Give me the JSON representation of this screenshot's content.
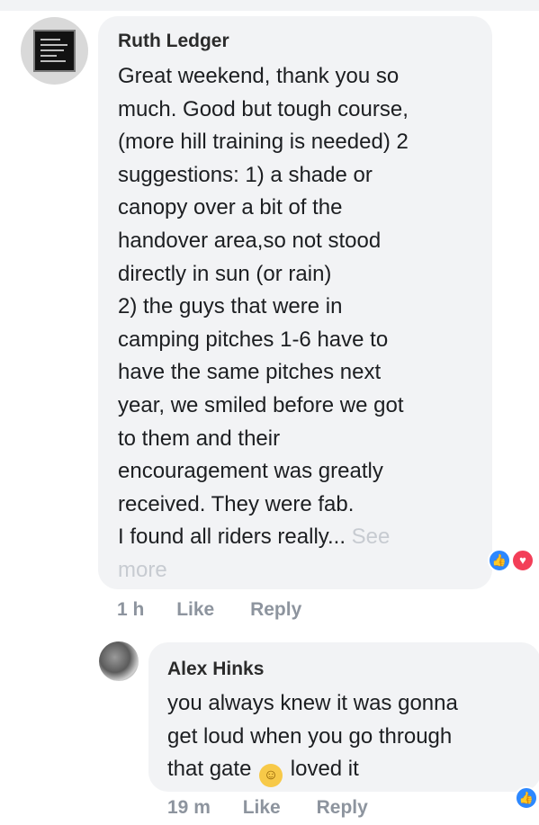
{
  "comments": [
    {
      "author": "Ruth Ledger",
      "text_lines": [
        "Great weekend, thank you so",
        "much. Good but tough course,",
        "(more hill training is needed) 2",
        "suggestions: 1) a shade or",
        "canopy over a bit of the",
        "handover area,so not stood",
        "directly in sun (or rain)",
        "2) the guys that were in",
        "camping pitches 1-6 have to",
        "have the same pitches next",
        "year, we smiled before we got",
        "to them and their",
        "encouragement was greatly",
        "received. They were fab.",
        "I found all riders really..."
      ],
      "see_more_label_1": "See",
      "see_more_label_2": "more",
      "time": "1 h",
      "like_label": "Like",
      "reply_label": "Reply",
      "reactions": [
        "like",
        "love"
      ]
    },
    {
      "author": "Alex Hinks",
      "text_lines": [
        "you always knew it was gonna",
        "get loud when you go through",
        "that gate"
      ],
      "text_after_emoji": "loved it",
      "emoji_name": "smiling-face-emoji",
      "time": "19 m",
      "like_label": "Like",
      "reply_label": "Reply",
      "reactions": [
        "like"
      ]
    }
  ],
  "colors": {
    "bubble": "#f2f3f5",
    "meta": "#8d949e",
    "like_reaction": "#2d88ff",
    "love_reaction": "#f33e58"
  }
}
